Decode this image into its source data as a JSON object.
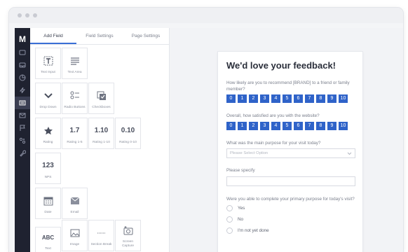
{
  "sidebar": {
    "logo": "M"
  },
  "builder": {
    "tabs": [
      "Add Field",
      "Field Settings",
      "Page Settings"
    ],
    "tiles": {
      "text_input": "Text Input",
      "text_area": "Text Area",
      "drop_down": "Drop Down",
      "radio_buttons": "Radio Buttons",
      "checkboxes": "Checkboxes",
      "rating": "Rating",
      "rating_1_5": {
        "value": "1.7",
        "label": "Rating 1-5"
      },
      "rating_1_10": {
        "value": "1.10",
        "label": "Rating 1-10"
      },
      "rating_0_10": {
        "value": "0.10",
        "label": "Rating 0-10"
      },
      "nps": {
        "value": "123",
        "label": "NPS"
      },
      "date": "Date",
      "email": "Email",
      "text": {
        "value": "ABC",
        "label": "Text"
      },
      "image": "Image",
      "section_break": "Section Break",
      "screen_capture": "Screen Capture"
    }
  },
  "form": {
    "title": "We'd love your feedback!",
    "q1": "How likely are you to recommend [BRAND] to a friend or family member?",
    "scale1": [
      "0",
      "1",
      "2",
      "3",
      "4",
      "5",
      "6",
      "7",
      "8",
      "9",
      "10"
    ],
    "q2": "Overall, how satisfied are you with the website?",
    "scale2": [
      "0",
      "1",
      "2",
      "3",
      "4",
      "5",
      "6",
      "7",
      "8",
      "9",
      "10"
    ],
    "q3": "What was the main purpose for your visit today?",
    "q3_placeholder": "Please Select Option",
    "q4": "Please specify",
    "q5": "Were you able to complete your primary purpose for today's visit?",
    "options": [
      "Yes",
      "No",
      "I'm not yet done"
    ]
  },
  "colors": {
    "accent": "#2f63c9",
    "sidebar": "#1f2230"
  }
}
